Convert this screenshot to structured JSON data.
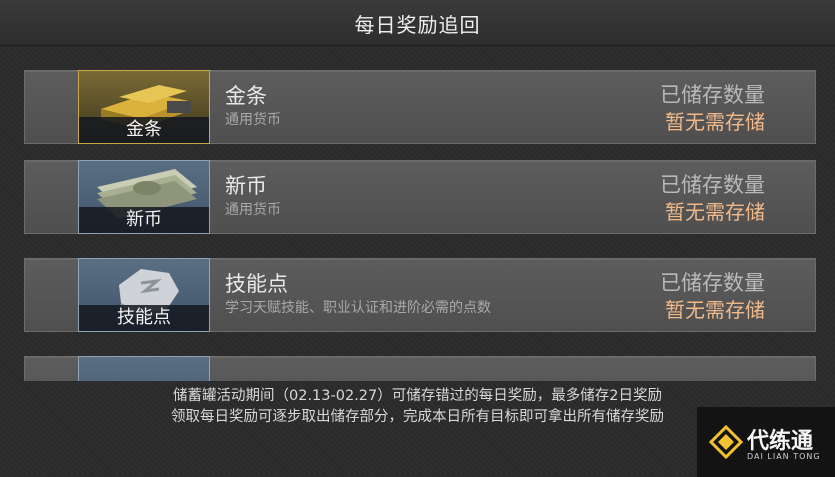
{
  "header": {
    "title": "每日奖励追回"
  },
  "rows": [
    {
      "thumb_label": "金条",
      "name": "金条",
      "desc": "通用货币",
      "stored_label": "已储存数量",
      "stored_value": "暂无需存储",
      "icon": "gold-bar-icon"
    },
    {
      "thumb_label": "新币",
      "name": "新币",
      "desc": "通用货币",
      "stored_label": "已储存数量",
      "stored_value": "暂无需存储",
      "icon": "banknote-stack-icon"
    },
    {
      "thumb_label": "技能点",
      "name": "技能点",
      "desc": "学习天赋技能、职业认证和进阶必需的点数",
      "stored_label": "已储存数量",
      "stored_value": "暂无需存储",
      "icon": "skill-coin-icon"
    },
    {
      "thumb_label": "",
      "name": "",
      "desc": "",
      "stored_label": "",
      "stored_value": "",
      "icon": ""
    }
  ],
  "footer": {
    "line1": "储蓄罐活动期间（02.13-02.27）可储存错过的每日奖励，最多储存2日奖励",
    "line2": "领取每日奖励可逐步取出储存部分，完成本日所有目标即可拿出所有储存奖励"
  },
  "watermark": {
    "main": "代练通",
    "sub": "DAI LIAN TONG"
  },
  "colors": {
    "accent_value": "#f0b98a",
    "row_bg": "#565656",
    "page_bg": "#2b2b2b"
  }
}
